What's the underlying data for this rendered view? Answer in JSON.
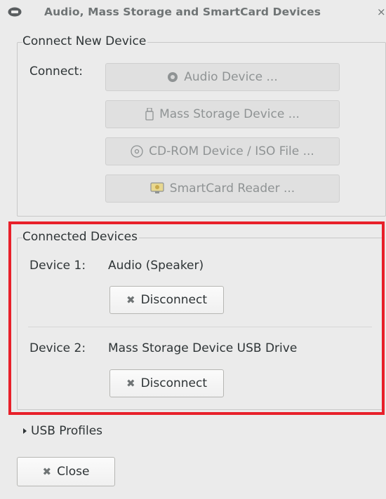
{
  "window": {
    "title": "Audio, Mass Storage and SmartCard Devices",
    "close_glyph": "×",
    "icon": "usb-icon"
  },
  "connect_new": {
    "frame_label": "Connect New Device",
    "connect_label": "Connect:",
    "buttons": [
      {
        "label": "Audio Device ...",
        "icon": "speaker-icon",
        "enabled": false
      },
      {
        "label": "Mass Storage Device ...",
        "icon": "usb-drive-icon",
        "enabled": false
      },
      {
        "label": "CD-ROM Device / ISO File ...",
        "icon": "cdrom-icon",
        "enabled": false
      },
      {
        "label": "SmartCard Reader ...",
        "icon": "smartcard-icon",
        "enabled": false
      }
    ]
  },
  "connected": {
    "frame_label": "Connected Devices",
    "devices": [
      {
        "label": "Device 1:",
        "name": "Audio (Speaker)",
        "action": "Disconnect"
      },
      {
        "label": "Device 2:",
        "name": "Mass Storage Device USB Drive",
        "action": "Disconnect"
      }
    ],
    "highlight_color": "#e8202a"
  },
  "usb_profiles": {
    "label": "USB Profiles",
    "expanded": false
  },
  "footer": {
    "close_label": "Close"
  }
}
